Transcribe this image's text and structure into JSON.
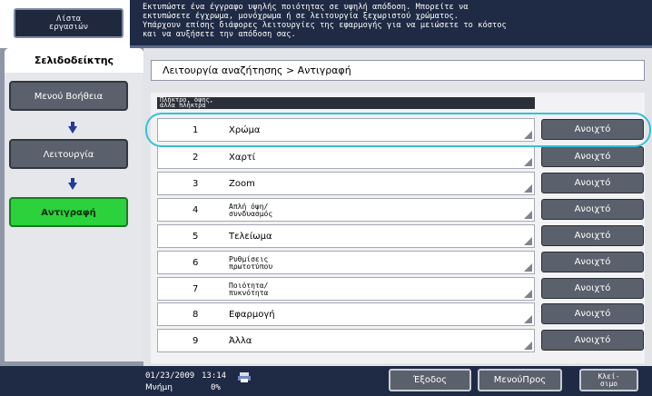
{
  "header": {
    "task_list_label": [
      "Λίστα",
      "εργασιών"
    ],
    "message": [
      "Εκτυπώστε ένα έγγραφο υψηλής ποιότητας σε υψηλή απόδοση. Μπορείτε να",
      "εκτυπώσετε έγχρωμα, μονόχρωμα ή σε λειτουργία ξεχωριστού χρώματος.",
      "Υπάρχουν επίσης διάφορες λειτουργίες της εφαρμογής για να μειώσετε το κόστος",
      "και να αυξήσετε την απόδοση σας."
    ]
  },
  "sidebar": {
    "tab_label": "Σελιδοδείκτης",
    "help_menu": "Μενού Βοήθεια",
    "function": "Λειτουργία",
    "copy": "Αντιγραφή"
  },
  "main": {
    "breadcrumb": "Λειτουργία αναζήτησης > Αντιγραφή",
    "list_header": [
      "Πλήκτρο, όψης,",
      "άλλα πλήκτρα"
    ],
    "open_label": "Ανοιχτό",
    "rows": [
      {
        "num": "1",
        "label": "Χρώμα"
      },
      {
        "num": "2",
        "label": "Χαρτί"
      },
      {
        "num": "3",
        "label": "Zoom"
      },
      {
        "num": "4",
        "label": "Απλή όψη/ συνδυασμός"
      },
      {
        "num": "5",
        "label": "Τελείωμα"
      },
      {
        "num": "6",
        "label": "Ρυθμίσεις πρωτοτύπου"
      },
      {
        "num": "7",
        "label": "Ποιότητα/ πυκνότητα"
      },
      {
        "num": "8",
        "label": "Εφαρμογή"
      },
      {
        "num": "9",
        "label": "Άλλα"
      }
    ]
  },
  "footer": {
    "date": "01/23/2009",
    "time": "13:14",
    "memory_label": "Μνήμη",
    "memory_value": "0%",
    "exit": "Έξοδος",
    "menu": "ΜενούΠρος",
    "close": [
      "Κλεί-",
      "σιμο"
    ]
  },
  "colors": {
    "highlight": "#35c1d8",
    "active": "#2bd23b",
    "bar": "#1f2a44"
  }
}
